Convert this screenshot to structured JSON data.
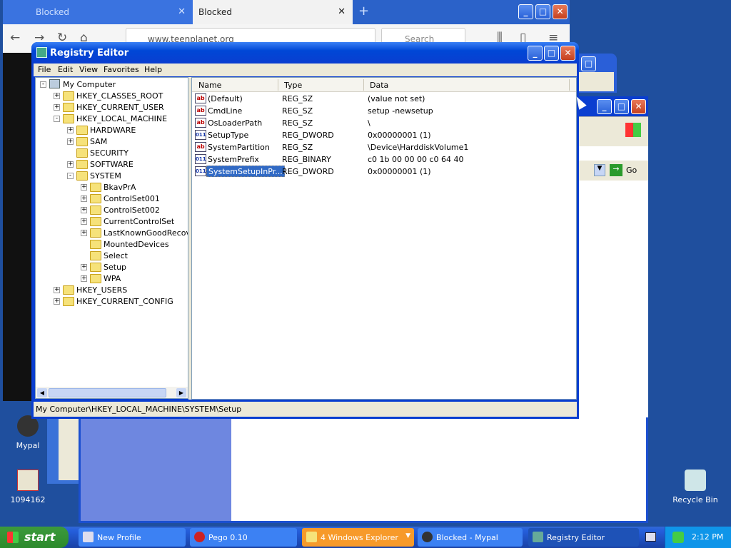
{
  "browser": {
    "tabs": [
      {
        "label": "Blocked"
      },
      {
        "label": "Blocked"
      }
    ],
    "url": "www.teenplanet.org",
    "search_placeholder": "Search"
  },
  "registry": {
    "title": "Registry Editor",
    "menu": [
      "File",
      "Edit",
      "View",
      "Favorites",
      "Help"
    ],
    "tree": [
      {
        "label": "My Computer",
        "level": 0,
        "exp": "-"
      },
      {
        "label": "HKEY_CLASSES_ROOT",
        "level": 1,
        "exp": "+"
      },
      {
        "label": "HKEY_CURRENT_USER",
        "level": 1,
        "exp": "+"
      },
      {
        "label": "HKEY_LOCAL_MACHINE",
        "level": 1,
        "exp": "-"
      },
      {
        "label": "HARDWARE",
        "level": 2,
        "exp": "+"
      },
      {
        "label": "SAM",
        "level": 2,
        "exp": "+"
      },
      {
        "label": "SECURITY",
        "level": 2,
        "exp": ""
      },
      {
        "label": "SOFTWARE",
        "level": 2,
        "exp": "+"
      },
      {
        "label": "SYSTEM",
        "level": 2,
        "exp": "-"
      },
      {
        "label": "BkavPrA",
        "level": 3,
        "exp": "+"
      },
      {
        "label": "ControlSet001",
        "level": 3,
        "exp": "+"
      },
      {
        "label": "ControlSet002",
        "level": 3,
        "exp": "+"
      },
      {
        "label": "CurrentControlSet",
        "level": 3,
        "exp": "+"
      },
      {
        "label": "LastKnownGoodRecove",
        "level": 3,
        "exp": "+"
      },
      {
        "label": "MountedDevices",
        "level": 3,
        "exp": ""
      },
      {
        "label": "Select",
        "level": 3,
        "exp": ""
      },
      {
        "label": "Setup",
        "level": 3,
        "exp": "+"
      },
      {
        "label": "WPA",
        "level": 3,
        "exp": "+"
      },
      {
        "label": "HKEY_USERS",
        "level": 1,
        "exp": "+"
      },
      {
        "label": "HKEY_CURRENT_CONFIG",
        "level": 1,
        "exp": "+"
      }
    ],
    "columns": [
      "Name",
      "Type",
      "Data"
    ],
    "values": [
      {
        "name": "(Default)",
        "type": "REG_SZ",
        "data": "(value not set)",
        "icon": "ab"
      },
      {
        "name": "CmdLine",
        "type": "REG_SZ",
        "data": "setup -newsetup",
        "icon": "ab"
      },
      {
        "name": "OsLoaderPath",
        "type": "REG_SZ",
        "data": "\\",
        "icon": "ab"
      },
      {
        "name": "SetupType",
        "type": "REG_DWORD",
        "data": "0x00000001 (1)",
        "icon": "bin"
      },
      {
        "name": "SystemPartition",
        "type": "REG_SZ",
        "data": "\\Device\\HarddiskVolume1",
        "icon": "ab"
      },
      {
        "name": "SystemPrefix",
        "type": "REG_BINARY",
        "data": "c0 1b 00 00 00 c0 64 40",
        "icon": "bin"
      },
      {
        "name": "SystemSetupInPr...",
        "type": "REG_DWORD",
        "data": "0x00000001 (1)",
        "icon": "bin",
        "selected": true
      }
    ],
    "status": "My Computer\\HKEY_LOCAL_MACHINE\\SYSTEM\\Setup"
  },
  "explorer": {
    "go_label": "Go"
  },
  "desktop_icons": [
    {
      "label": "Mypal"
    },
    {
      "label": "1094162"
    },
    {
      "label": "Recycle Bin"
    }
  ],
  "taskbar": {
    "start": "start",
    "buttons": [
      {
        "label": "New Profile"
      },
      {
        "label": "Pego 0.10"
      },
      {
        "label": "4 Windows Explorer"
      },
      {
        "label": "Blocked - Mypal"
      },
      {
        "label": "Registry Editor"
      }
    ],
    "clock": "2:12 PM"
  }
}
